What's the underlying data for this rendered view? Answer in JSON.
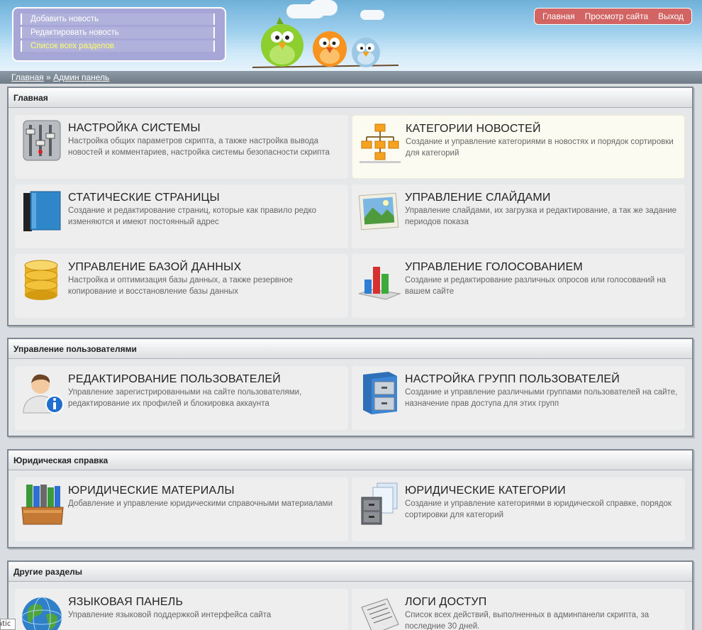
{
  "header": {
    "quick_menu": [
      {
        "label": "Добавить новость"
      },
      {
        "label": "Редактировать новость"
      },
      {
        "label": "Список всех разделов"
      }
    ],
    "top_nav": [
      {
        "label": "Главная"
      },
      {
        "label": "Просмотр сайта"
      },
      {
        "label": "Выход"
      }
    ]
  },
  "breadcrumb": {
    "home": "Главная",
    "separator": "»",
    "current": "Админ панель"
  },
  "sections": [
    {
      "title": "Главная",
      "cards": [
        {
          "title": "НАСТРОЙКА СИСТЕМЫ",
          "desc": "Настройка общих параметров скрипта, а также настройка вывода новостей и комментариев, настройка системы безопасности скрипта",
          "icon": "mixer-settings-icon"
        },
        {
          "title": "КАТЕГОРИИ НОВОСТЕЙ",
          "desc": "Создание и управление категориями в новостях и порядок сортировки для категорий",
          "icon": "hierarchy-icon"
        },
        {
          "title": "СТАТИЧЕСКИЕ СТРАНИЦЫ",
          "desc": "Создание и редактирование страниц, которые как правило редко изменяются и имеют постоянный адрес",
          "icon": "book-icon"
        },
        {
          "title": "УПРАВЛЕНИЕ СЛАЙДАМИ",
          "desc": "Управление слайдами, их загрузка и редактирование, а так же задание периодов показа",
          "icon": "picture-icon"
        },
        {
          "title": "УПРАВЛЕНИЕ БАЗОЙ ДАННЫХ",
          "desc": "Настройка и оптимизация базы данных, а также резервное копирование и восстановление базы данных",
          "icon": "database-icon"
        },
        {
          "title": "УПРАВЛЕНИЕ ГОЛОСОВАНИЕМ",
          "desc": "Создание и редактирование различных опросов или голосований на вашем сайте",
          "icon": "bar-chart-icon"
        }
      ]
    },
    {
      "title": "Управление пользователями",
      "cards": [
        {
          "title": "РЕДАКТИРОВАНИЕ ПОЛЬЗОВАТЕЛЕЙ",
          "desc": "Управление зарегистрированными на сайте пользователями, редактирование их профилей и блокировка аккаунта",
          "icon": "user-info-icon"
        },
        {
          "title": "НАСТРОЙКА ГРУПП ПОЛЬЗОВАТЕЛЕЙ",
          "desc": "Создание и управление различными группами пользователей на сайте, назначение прав доступа для этих групп",
          "icon": "file-cabinet-icon"
        }
      ]
    },
    {
      "title": "Юридическая справка",
      "cards": [
        {
          "title": "ЮРИДИЧЕСКИЕ МАТЕРИАЛЫ",
          "desc": "Добавление и управление юридическими справочными материалами",
          "icon": "binders-icon"
        },
        {
          "title": "ЮРИДИЧЕСКИЕ КАТЕГОРИИ",
          "desc": "Создание и управление категориями в юридической справке, порядок сортировки для категорий",
          "icon": "cabinet-documents-icon"
        }
      ]
    },
    {
      "title": "Другие разделы",
      "cards": [
        {
          "title": "ЯЗЫКОВАЯ ПАНЕЛЬ",
          "desc": "Управление языковой поддержкой интерфейса сайта",
          "icon": "globe-icon"
        },
        {
          "title": "ЛОГИ ДОСТУП",
          "desc": "Список всех действий, выполненных в админпанели скрипта, за последние 30 дней.",
          "icon": "log-document-icon"
        }
      ]
    }
  ],
  "status": {
    "text": "atic"
  }
}
